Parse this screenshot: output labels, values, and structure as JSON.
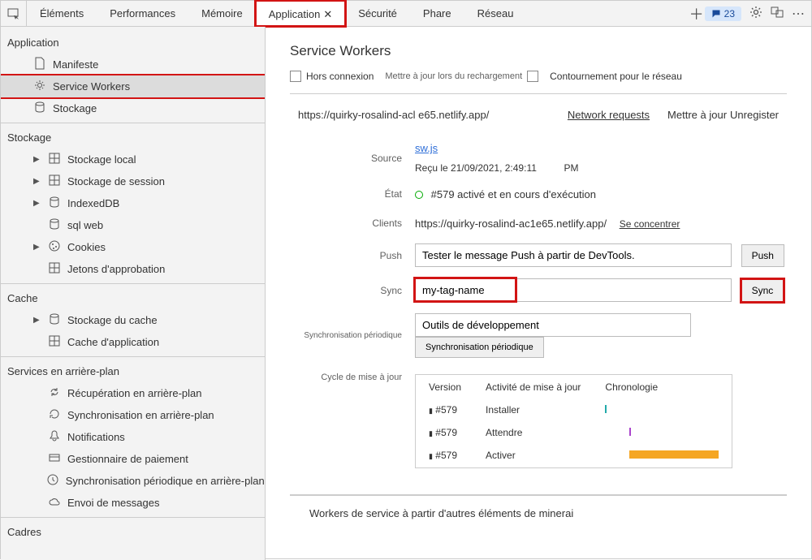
{
  "tabs": {
    "elements": "Éléments",
    "performance": "Performances",
    "memory": "Mémoire",
    "application": "Application",
    "security": "Sécurité",
    "lighthouse": "Phare",
    "network": "Réseau"
  },
  "messages_count": "23",
  "sidebar": {
    "application": {
      "label": "Application",
      "manifest": "Manifeste",
      "service_workers": "Service Workers",
      "storage": "Stockage"
    },
    "storage": {
      "label": "Stockage",
      "local": "Stockage local",
      "session": "Stockage de session",
      "indexeddb": "IndexedDB",
      "websql": "sql web",
      "cookies": "Cookies",
      "trust_tokens": "Jetons d'approbation"
    },
    "cache": {
      "label": "Cache",
      "cache_storage": "Stockage du cache",
      "app_cache": "Cache d'application"
    },
    "bg_services": {
      "label": "Services en arrière-plan",
      "bg_fetch": "Récupération en arrière-plan",
      "bg_sync": "Synchronisation en arrière-plan",
      "notifications": "Notifications",
      "payment": "Gestionnaire de paiement",
      "periodic_sync": "Synchronisation périodique en arrière-plan",
      "push": "Envoi de messages"
    },
    "frames": "Cadres"
  },
  "page": {
    "title": "Service Workers",
    "offline": "Hors connexion",
    "update_reload": "Mettre à jour lors du rechargement",
    "bypass": "Contournement pour le réseau",
    "sw_url": "https://quirky-rosalind-acl e65.netlify.app/",
    "net_requests": "Network requests",
    "update": "Mettre à jour",
    "unregister": "Unregister"
  },
  "form": {
    "source_label": "Source",
    "source_link": "sw.js",
    "received": "Reçu le 21/09/2021, 2:49:11",
    "received_suffix": "PM",
    "status_label": "État",
    "status_value": "#579 activé et en cours d'exécution",
    "clients_label": "Clients",
    "clients_value": "https://quirky-rosalind-ac1e65.netlify.app/",
    "focus": "Se concentrer",
    "push_label": "Push",
    "push_placeholder": "Tester le message Push à partir de DevTools.",
    "push_btn": "Push",
    "sync_label": "Sync",
    "sync_value": "my-tag-name",
    "sync_btn": "Sync",
    "periodic_label": "Synchronisation périodique",
    "periodic_placeholder": "Outils de développement",
    "periodic_btn": "Synchronisation périodique",
    "cycle_label": "Cycle de mise à jour"
  },
  "update_table": {
    "th_version": "Version",
    "th_activity": "Activité de mise à jour",
    "th_timeline": "Chronologie",
    "rows": [
      {
        "version": "#579",
        "activity": "Installer"
      },
      {
        "version": "#579",
        "activity": "Attendre"
      },
      {
        "version": "#579",
        "activity": "Activer"
      }
    ]
  },
  "bottom_note": "Workers de service à partir d'autres éléments de minerai"
}
